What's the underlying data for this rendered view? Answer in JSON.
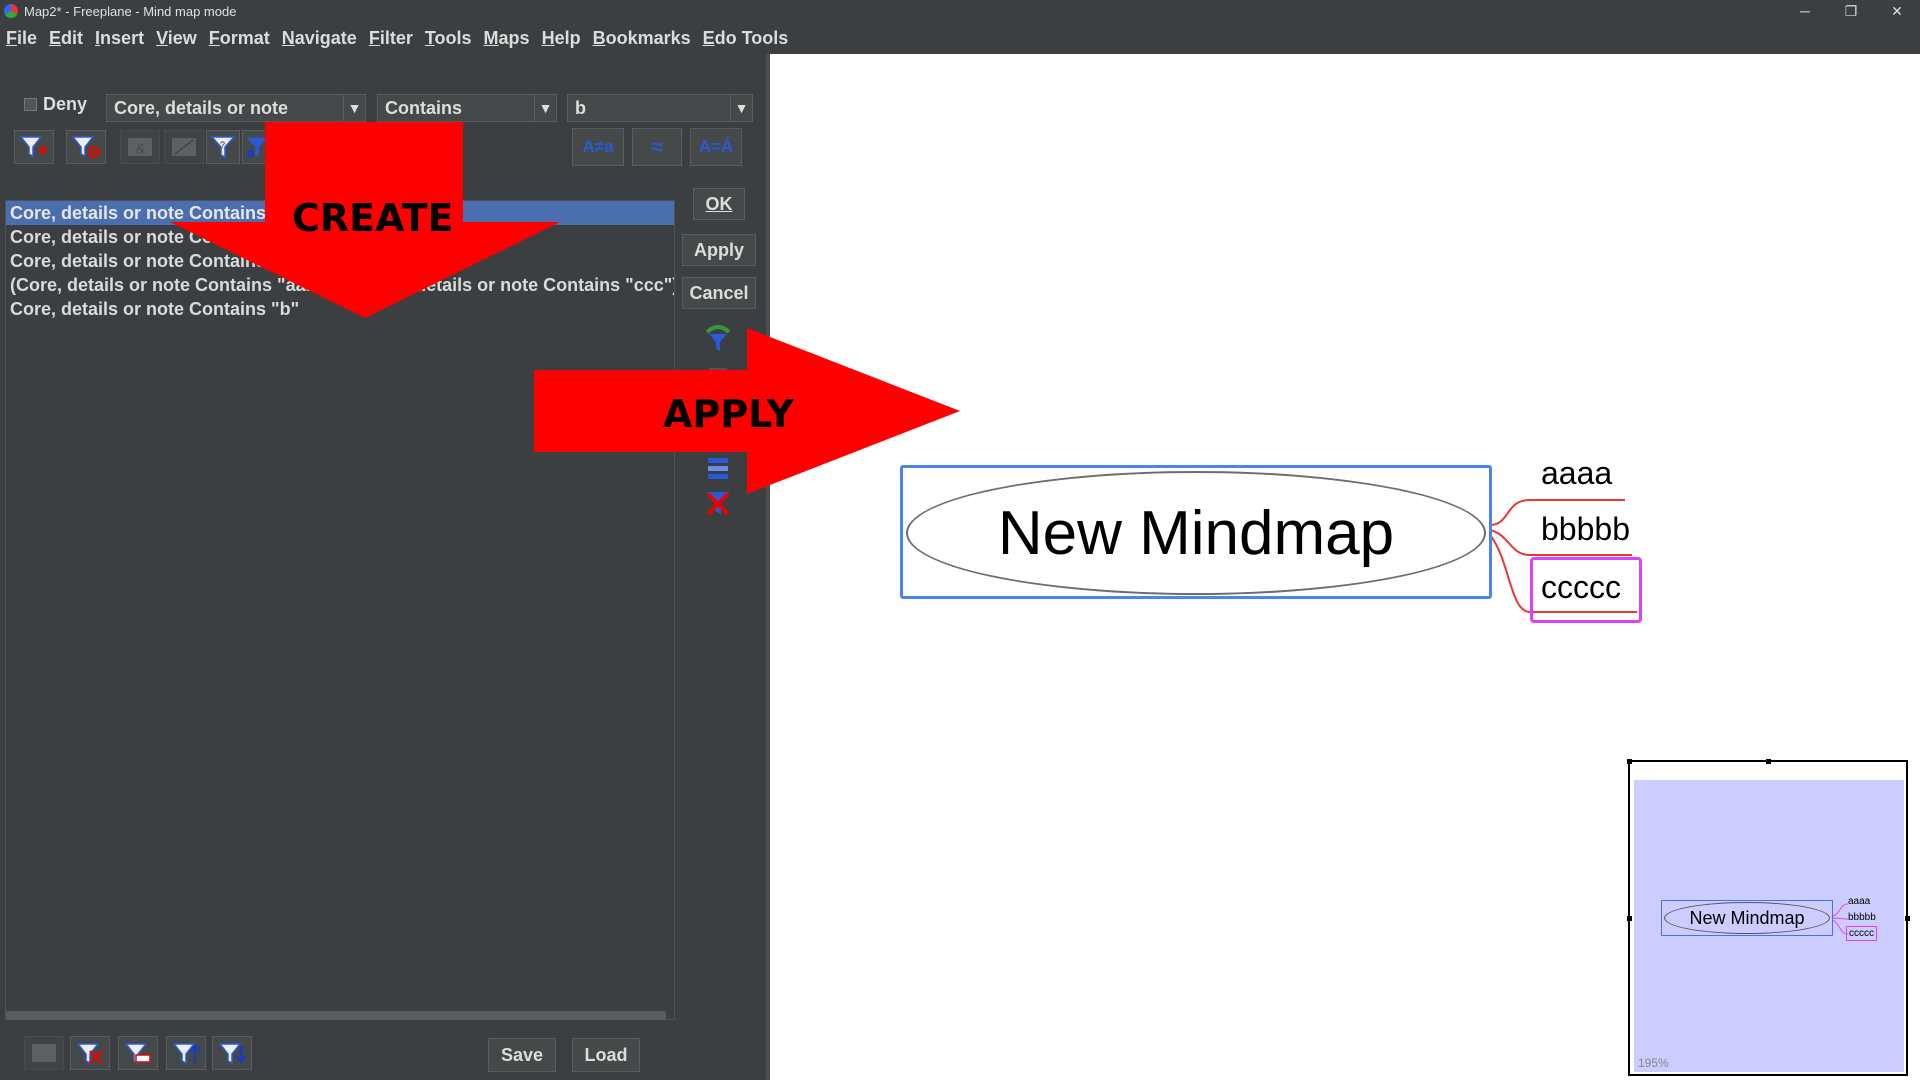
{
  "window": {
    "title": "Map2* - Freeplane - Mind map mode",
    "minimize": "─",
    "restore": "❐",
    "close": "✕"
  },
  "menu": [
    "File",
    "Edit",
    "Insert",
    "View",
    "Format",
    "Navigate",
    "Filter",
    "Tools",
    "Maps",
    "Help",
    "Bookmarks",
    "Edo Tools"
  ],
  "filter": {
    "deny_label": "Deny",
    "property_value": "Core, details or note",
    "operator_value": "Contains",
    "search_value": "b",
    "list_items": [
      "Core, details or note Contains \"b\"",
      "Core, details or note Contains \"aaa\"",
      "Core, details or note Contains \"ccc\"",
      "(Core, details or note Contains \"aaa\") or (Core, details or note Contains \"ccc\")",
      "Core, details or note Contains \"b\""
    ],
    "ok_label": "OK",
    "apply_label": "Apply",
    "cancel_label": "Cancel",
    "save_label": "Save",
    "load_label": "Load",
    "match_case_label": "A≠a",
    "approximate_label": "≈",
    "ignore_diacritics_label": "A=Á"
  },
  "annotations": {
    "create_label": "CREATE",
    "apply_label": "APPLY",
    "arrow_color": "#ff0000"
  },
  "mindmap": {
    "root_text": "New Mindmap",
    "children": [
      "aaaa",
      "bbbbb",
      "ccccc"
    ],
    "edge_color": "#e53935",
    "highlight_color": "#e040fb"
  },
  "minimap": {
    "root_text": "New Mindmap",
    "children": [
      "aaaa",
      "bbbbb",
      "ccccc"
    ],
    "zoom": "195%"
  }
}
